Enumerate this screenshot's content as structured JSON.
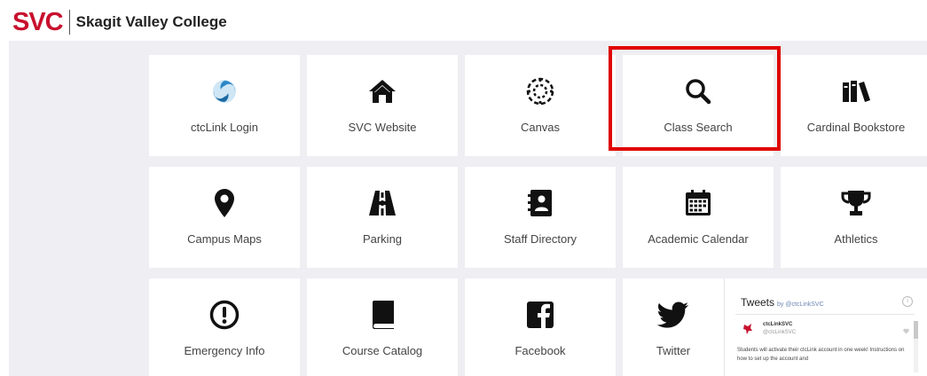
{
  "header": {
    "logo_abbr": "SVC",
    "college_name": "Skagit Valley College",
    "brand_color": "#c8102e"
  },
  "tiles": [
    {
      "label": "ctcLink Login",
      "icon": "ctclink-logo-icon"
    },
    {
      "label": "SVC Website",
      "icon": "home-icon"
    },
    {
      "label": "Canvas",
      "icon": "canvas-logo-icon"
    },
    {
      "label": "Class Search",
      "icon": "search-icon",
      "highlighted": true
    },
    {
      "label": "Cardinal Bookstore",
      "icon": "books-icon"
    },
    {
      "label": "Campus Maps",
      "icon": "map-pin-icon"
    },
    {
      "label": "Parking",
      "icon": "road-icon"
    },
    {
      "label": "Staff Directory",
      "icon": "address-book-icon"
    },
    {
      "label": "Academic Calendar",
      "icon": "calendar-icon"
    },
    {
      "label": "Athletics",
      "icon": "trophy-icon"
    },
    {
      "label": "Emergency Info",
      "icon": "exclamation-circle-icon"
    },
    {
      "label": "Course Catalog",
      "icon": "book-icon"
    },
    {
      "label": "Facebook",
      "icon": "facebook-icon"
    },
    {
      "label": "Twitter",
      "icon": "twitter-bird-icon"
    }
  ],
  "twitter_widget": {
    "title": "Tweets",
    "by": "by @ctcLinkSVC",
    "info": "i",
    "tweet": {
      "name": "ctcLinkSVC",
      "handle": "@ctcLinkSVC",
      "text": "Students will activate their ctcLink account in one week! Instructions on how to set up the account and"
    }
  },
  "colors": {
    "highlight": "#e00000",
    "background": "#eeeef3",
    "tile": "#ffffff",
    "ctclink_blue": "#2a87c6"
  }
}
